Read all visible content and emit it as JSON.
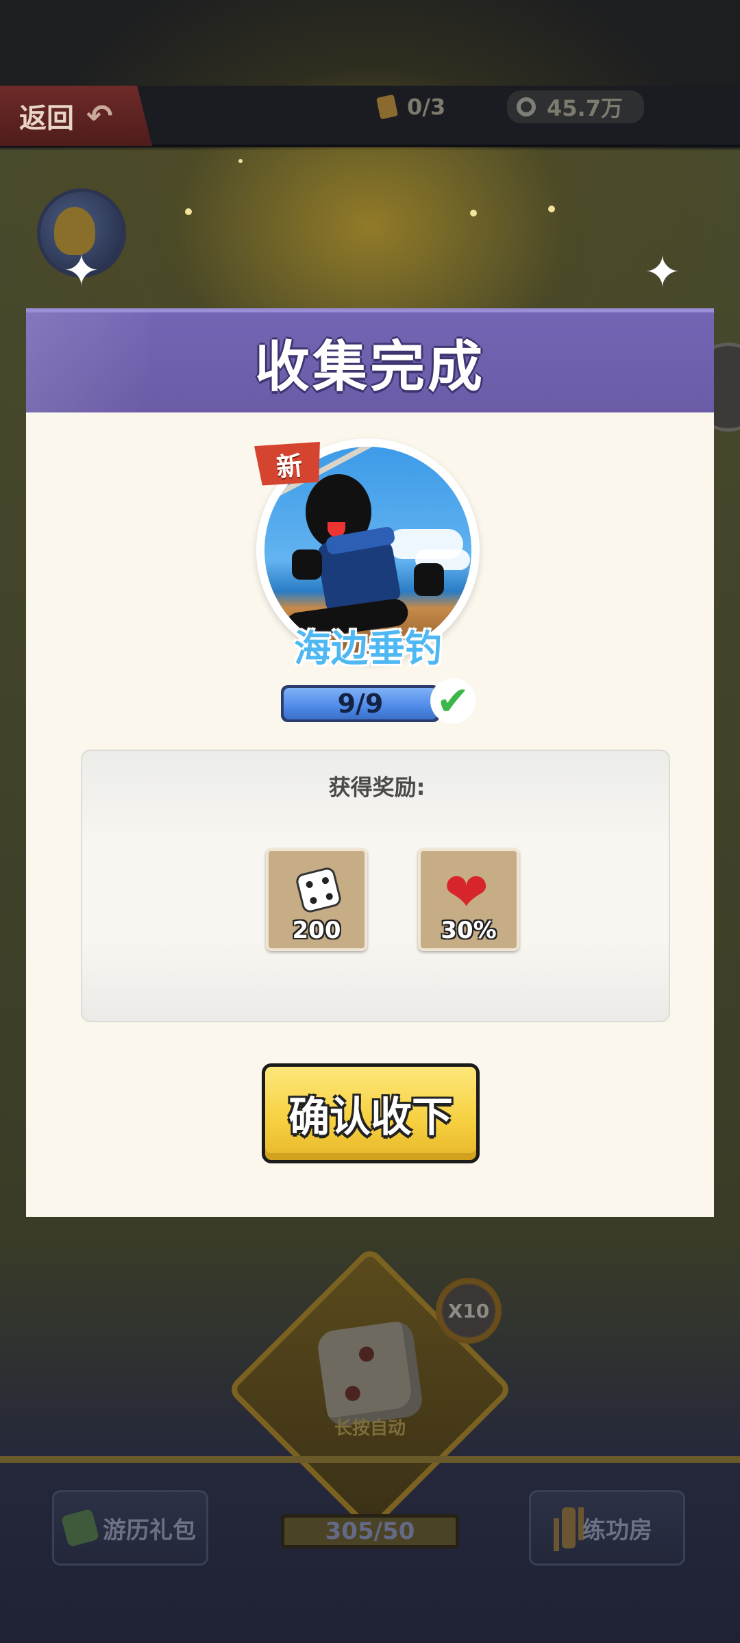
{
  "top_bar": {
    "back_label": "返回",
    "ticket_count": "0/3",
    "coin_count": "45.7万"
  },
  "game": {
    "x10_label": "X10",
    "dice_hint": "长按自动",
    "left_button": "游历礼包",
    "right_button": "练功房",
    "steps_counter": "305/50"
  },
  "modal": {
    "title": "收集完成",
    "new_badge": "新",
    "item_name": "海边垂钓",
    "progress_text": "9/9",
    "progress_fraction": 1.0,
    "rewards_title": "获得奖励:",
    "rewards": [
      {
        "icon": "dice-icon",
        "value": "200"
      },
      {
        "icon": "heart-icon",
        "value": "30%"
      }
    ],
    "confirm_label": "确认收下"
  },
  "colors": {
    "header_purple": "#6b5ba7",
    "button_yellow": "#f6cf3e",
    "progress_blue": "#4f8ae8",
    "check_green": "#3cb84a"
  }
}
